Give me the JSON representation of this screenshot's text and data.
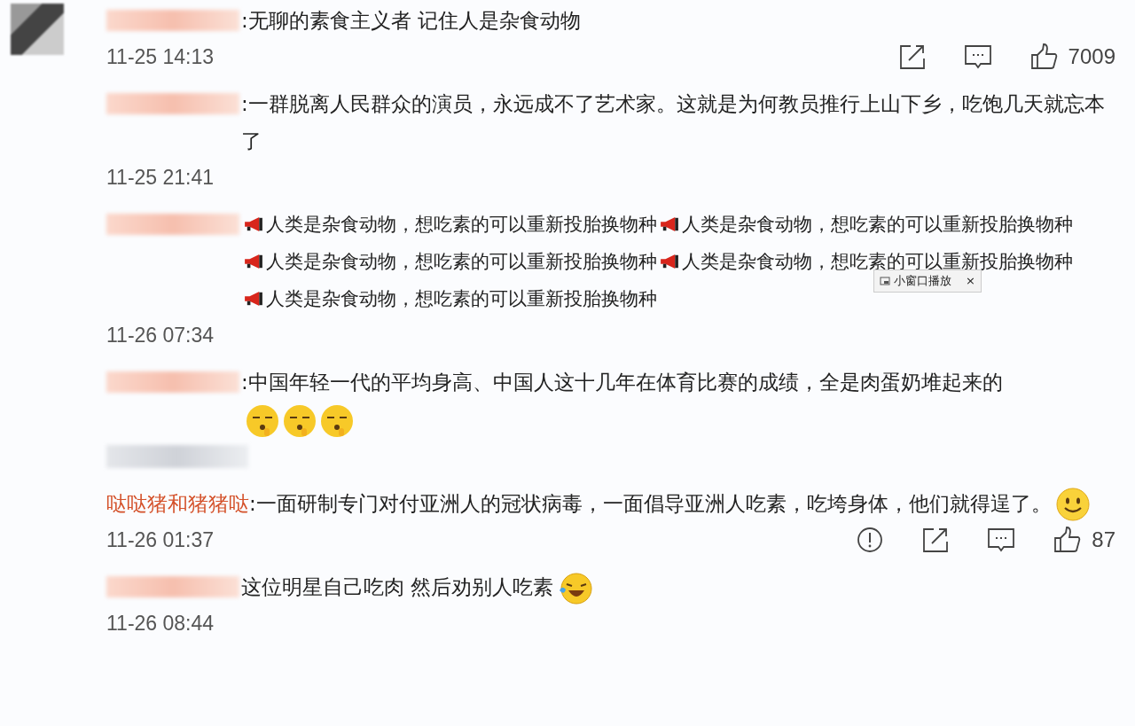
{
  "comments": [
    {
      "author": {
        "hidden": true
      },
      "text": ":无聊的素食主义者 记住人是杂食动物",
      "time": "11-25 14:13",
      "time_hidden": false,
      "avatar": true,
      "actions": [
        {
          "kind": "share"
        },
        {
          "kind": "comment"
        },
        {
          "kind": "like",
          "count": "7009"
        }
      ]
    },
    {
      "author": {
        "hidden": true
      },
      "text": ":一群脱离人民群众的演员，永远成不了艺术家。这就是为何教员推行上山下乡，吃饱几天就忘本了",
      "time": "11-25 21:41",
      "time_hidden": false
    },
    {
      "author": {
        "hidden": true
      },
      "segments": [
        "人类是杂食动物，想吃素的可以重新投胎换物种",
        "人类是杂食动物，想吃素的可以重新投胎换物种",
        "人类是杂食动物，想吃素的可以重新投胎换物种",
        "人类是杂食动物，想吃素的可以重新投胎换物种",
        "人类是杂食动物，想吃素的可以重新投胎换物种"
      ],
      "time": "11-26 07:34",
      "time_hidden": false,
      "popup": {
        "label": "小窗口播放",
        "close": "×"
      }
    },
    {
      "author": {
        "hidden": true
      },
      "text": ":中国年轻一代的平均身高、中国人这十几年在体育比赛的成绩，全是肉蛋奶堆起来的",
      "emojis": [
        {
          "kind": "shush"
        },
        {
          "kind": "shush"
        },
        {
          "kind": "shush"
        }
      ],
      "time_hidden": true
    },
    {
      "author": {
        "hidden": false,
        "name": "哒哒猪和猪猪哒"
      },
      "text": ":一面研制专门对付亚洲人的冠状病毒，一面倡导亚洲人吃素，吃垮身体，他们就得逞了。",
      "emojis": [
        {
          "kind": "smile"
        }
      ],
      "time": "11-26 01:37",
      "time_hidden": false,
      "actions": [
        {
          "kind": "report"
        },
        {
          "kind": "share"
        },
        {
          "kind": "comment"
        },
        {
          "kind": "like",
          "count": "87"
        }
      ]
    },
    {
      "author": {
        "hidden": true
      },
      "text": "这位明星自己吃肉 然后劝别人吃素",
      "emojis": [
        {
          "kind": "laughcry"
        }
      ],
      "time": "11-26 08:44",
      "time_hidden": false
    }
  ]
}
